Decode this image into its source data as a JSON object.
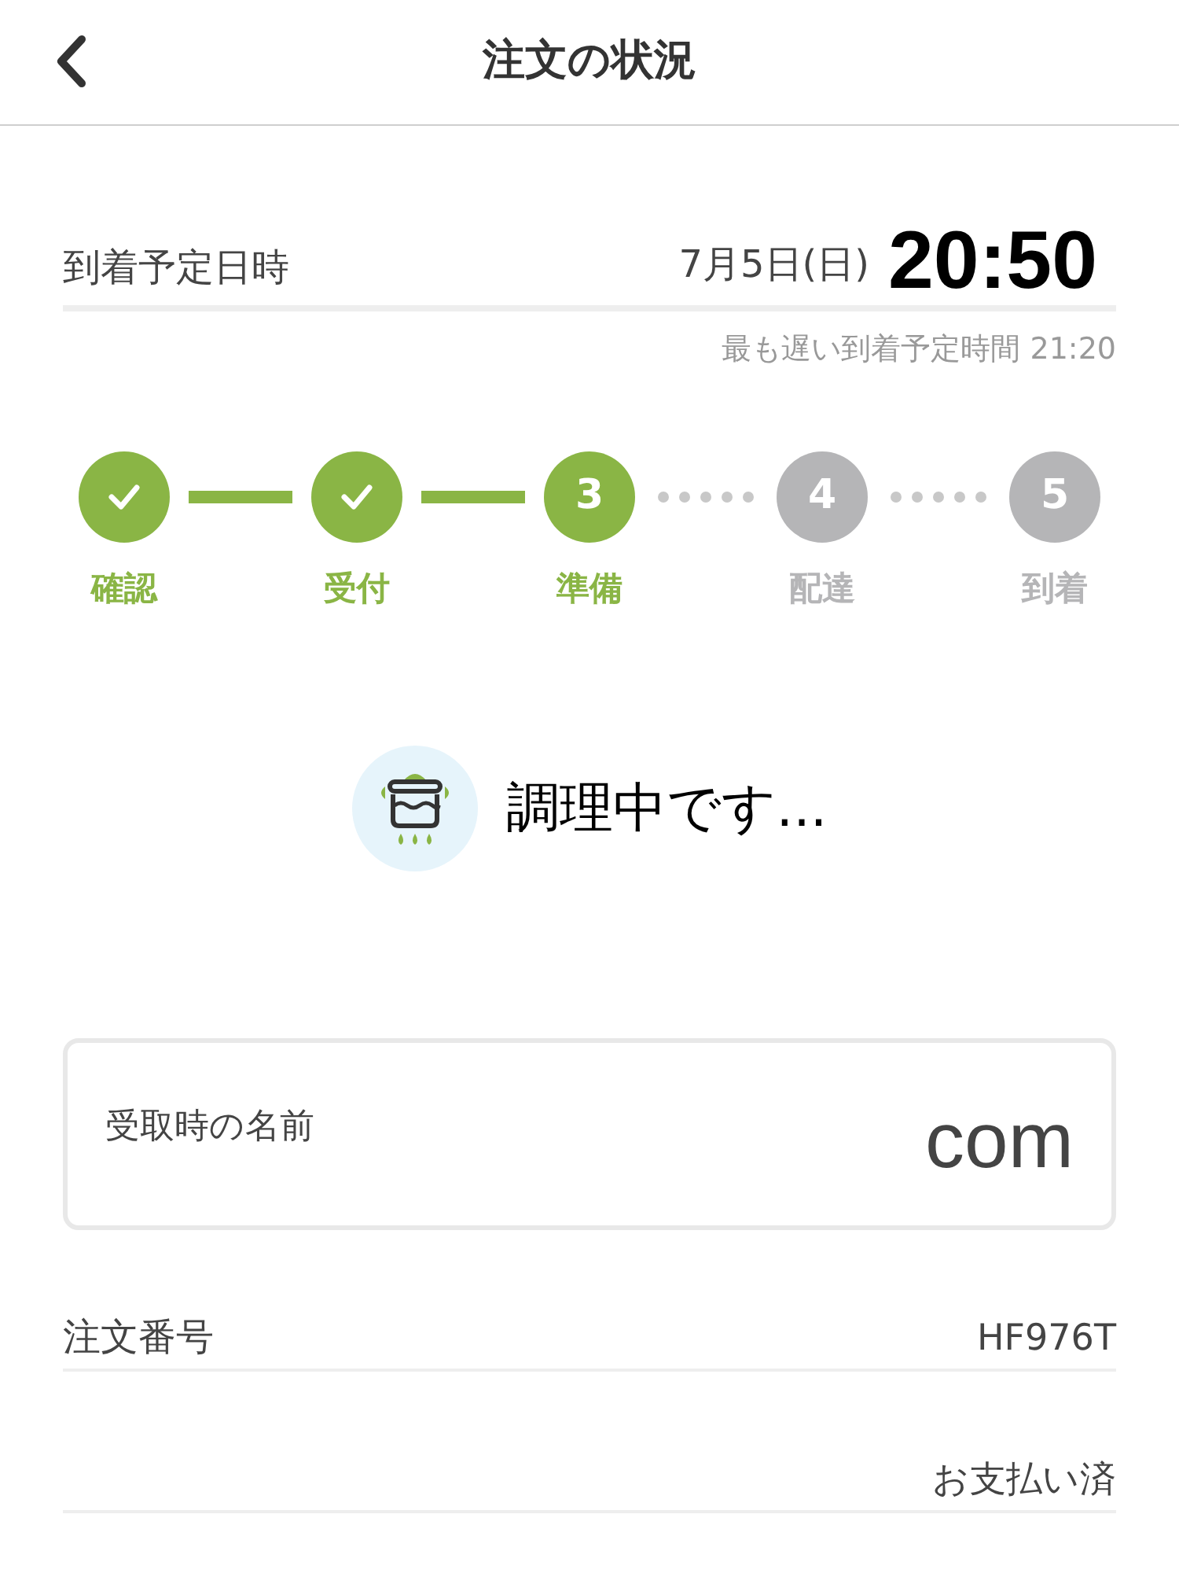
{
  "header": {
    "title": "注文の状況"
  },
  "arrival": {
    "label": "到着予定日時",
    "date": "7月5日(日)",
    "time": "20:50",
    "latest": "最も遅い到着予定時間 21:20"
  },
  "steps": [
    {
      "label": "確認",
      "kind": "done"
    },
    {
      "label": "受付",
      "kind": "done"
    },
    {
      "label": "準備",
      "number": "3",
      "kind": "current"
    },
    {
      "label": "配達",
      "number": "4",
      "kind": "pending"
    },
    {
      "label": "到着",
      "number": "5",
      "kind": "pending"
    }
  ],
  "status": "調理中です...",
  "pickup": {
    "label": "受取時の名前",
    "value": "com"
  },
  "rows": [
    {
      "label": "注文番号",
      "value": "HF976T"
    },
    {
      "value": "お支払い済"
    }
  ]
}
